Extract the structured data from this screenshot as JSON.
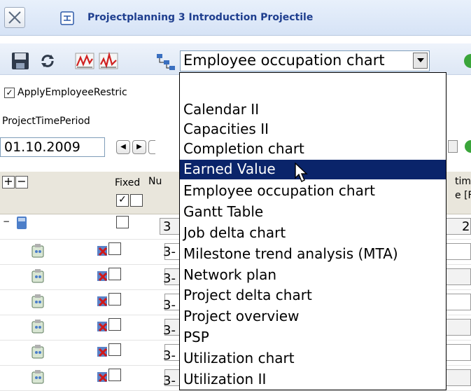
{
  "window": {
    "title": "Projectplanning 3 Introduction Projectile"
  },
  "icons": {
    "close": "close-icon",
    "tree": "tree-icon",
    "save": "save-icon",
    "refresh": "refresh-icon",
    "chart_a": "chart-red-icon",
    "chart_b": "chart-red-2-icon",
    "network": "network-icon"
  },
  "toolbar": {
    "combo_value": "Employee occupation chart"
  },
  "filters": {
    "apply_restriction_label": "ApplyEmployeeRestric",
    "time_period_label": "ProjectTimePeriod",
    "date_value": "01.10.2009"
  },
  "grid": {
    "fixed_header": "Fixed",
    "number_header": "Nu",
    "right_header_1": "tima",
    "right_header_2": "e [F",
    "rows": [
      {
        "num": "3",
        "right": "2"
      },
      {
        "num": "3-",
        "right": ""
      },
      {
        "num": "3-",
        "right": ""
      },
      {
        "num": "3-",
        "right": ""
      },
      {
        "num": "3-",
        "right": ""
      },
      {
        "num": "3-",
        "right": ""
      },
      {
        "num": "3-",
        "right": ""
      },
      {
        "num": "3-",
        "right": ""
      }
    ]
  },
  "dropdown": {
    "selected_index": 3,
    "options": [
      "Calendar II",
      "Capacities II",
      "Completion chart",
      "Earned Value",
      "Employee occupation chart",
      "Gantt Table",
      "Job delta chart",
      "Milestone trend analysis (MTA)",
      "Network plan",
      "Project delta chart",
      "Project overview",
      "PSP",
      "Utilization chart",
      "Utilization II"
    ]
  },
  "colors": {
    "highlight": "#0a246a",
    "title": "#1f3f8f",
    "accent_green": "#3aa53a"
  }
}
